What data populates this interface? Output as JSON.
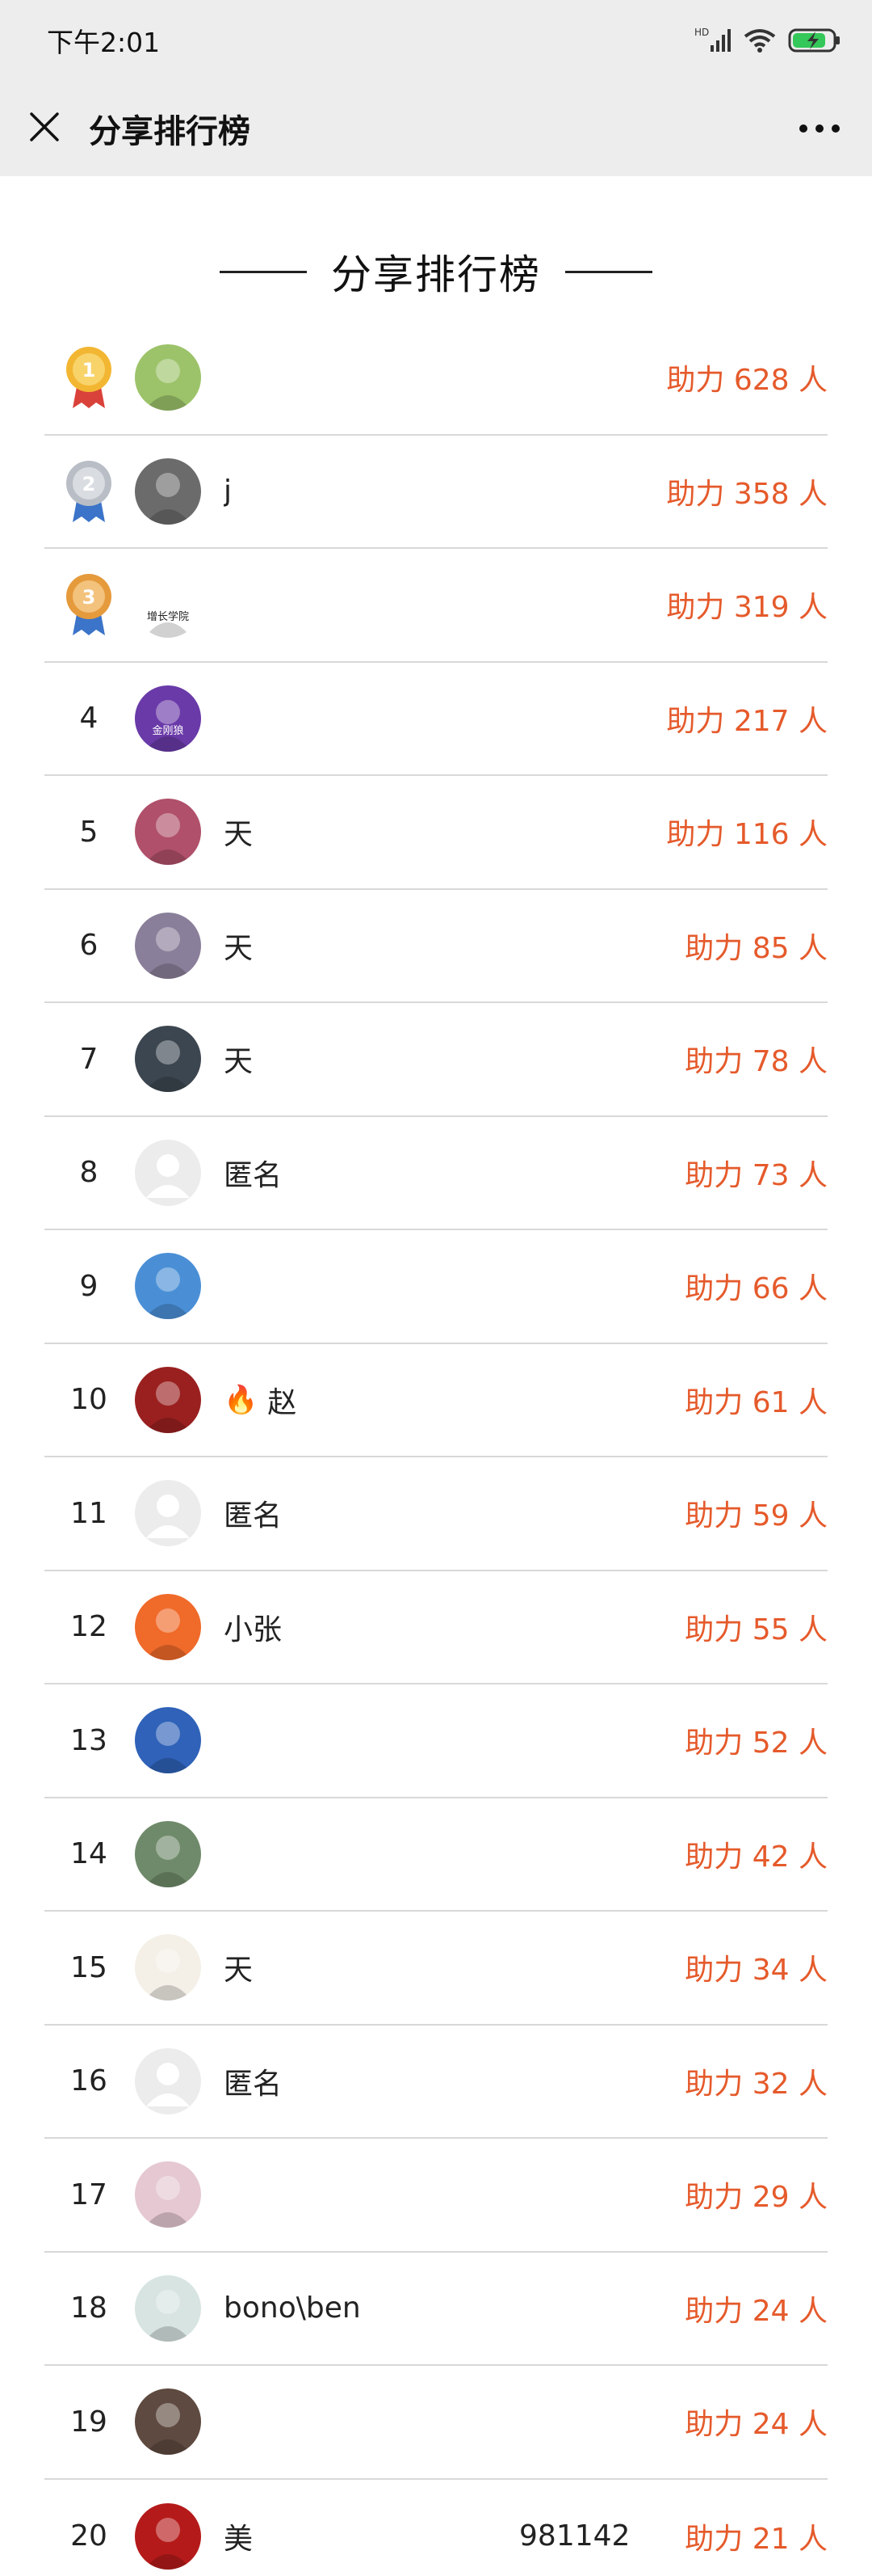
{
  "status_bar": {
    "time": "下午2:01",
    "network_label": "HD",
    "icons": [
      "signal-icon",
      "wifi-icon",
      "battery-charging-icon"
    ]
  },
  "nav": {
    "title": "分享排行榜",
    "close_icon": "close-icon",
    "more_icon": "more-icon"
  },
  "heading": "分享排行榜",
  "ranking": [
    {
      "rank": "1",
      "medal": "gold",
      "name": "",
      "count": "助力 628 人",
      "avatar_color": "#9cc36a"
    },
    {
      "rank": "2",
      "medal": "silver",
      "name": "j",
      "count": "助力 358 人",
      "avatar_color": "#6b6b6b"
    },
    {
      "rank": "3",
      "medal": "bronze",
      "name": "",
      "count": "助力 319 人",
      "avatar_color": "#ffffff",
      "avatar_text": "增长学院"
    },
    {
      "rank": "4",
      "name": "",
      "count": "助力 217 人",
      "avatar_color": "#6a3aa8",
      "avatar_text": "金刚狼"
    },
    {
      "rank": "5",
      "name": "天",
      "count": "助力 116 人",
      "avatar_color": "#b0506a"
    },
    {
      "rank": "6",
      "name": "天",
      "count": "助力 85 人",
      "avatar_color": "#8a7f9a"
    },
    {
      "rank": "7",
      "name": "天",
      "count": "助力 78 人",
      "avatar_color": "#3c4650"
    },
    {
      "rank": "8",
      "name": "匿名",
      "count": "助力 73 人",
      "avatar_color": "#e9e9e9"
    },
    {
      "rank": "9",
      "name": "",
      "count": "助力 66 人",
      "avatar_color": "#4a8fd6"
    },
    {
      "rank": "10",
      "name": "赵",
      "count": "助力 61 人",
      "avatar_color": "#9a2020",
      "flame": "🔥"
    },
    {
      "rank": "11",
      "name": "匿名",
      "count": "助力 59 人",
      "avatar_color": "#e9e9e9"
    },
    {
      "rank": "12",
      "name": "小张",
      "count": "助力 55 人",
      "avatar_color": "#f06a2a"
    },
    {
      "rank": "13",
      "name": "",
      "count": "助力 52 人",
      "avatar_color": "#2f62b8"
    },
    {
      "rank": "14",
      "name": "",
      "count": "助力 42 人",
      "avatar_color": "#6f8a6a"
    },
    {
      "rank": "15",
      "name": "天",
      "count": "助力 34 人",
      "avatar_color": "#f4f0e8"
    },
    {
      "rank": "16",
      "name": "匿名",
      "count": "助力 32 人",
      "avatar_color": "#e9e9e9"
    },
    {
      "rank": "17",
      "name": "",
      "count": "助力 29 人",
      "avatar_color": "#e5c8d2"
    },
    {
      "rank": "18",
      "name": "bono\\ben",
      "count": "助力 24 人",
      "avatar_color": "#d7e4e2"
    },
    {
      "rank": "19",
      "name": "",
      "count": "助力 24 人",
      "avatar_color": "#5e4a40"
    },
    {
      "rank": "20",
      "name": "美",
      "name_suffix": "981142",
      "count": "助力 21 人",
      "avatar_color": "#b51a1a"
    }
  ]
}
